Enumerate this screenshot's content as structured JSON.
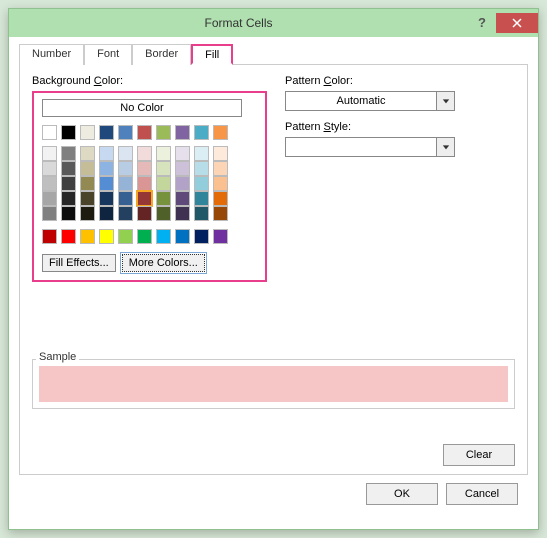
{
  "title": "Format Cells",
  "tabs": {
    "number": "Number",
    "font": "Font",
    "border": "Border",
    "fill": "Fill"
  },
  "labels": {
    "bgcolor_pre": "Background ",
    "bgcolor_u": "C",
    "bgcolor_post": "olor:",
    "nocolor_pre": "",
    "nocolor_u": "N",
    "nocolor_post": "o Color",
    "fe_pre": "Fill ",
    "fe_u": "E",
    "fe_post": "ffects...",
    "mc_u": "M",
    "mc_post": "ore Colors...",
    "pc_pre": "Pattern ",
    "pc_u": "C",
    "pc_post": "olor:",
    "ps_pre": "Pattern ",
    "ps_u": "S",
    "ps_post": "tyle:",
    "sample": "Sample",
    "clear": "Clea",
    "clear_u": "r",
    "ok": "OK",
    "cancel": "Cancel"
  },
  "pattern_color_value": "Automatic",
  "pattern_style_value": "",
  "sample_color": "#f6c6c6",
  "theme_colors_row1": [
    "#ffffff",
    "#000000",
    "#eeece1",
    "#1f497d",
    "#4f81bd",
    "#c0504d",
    "#9bbb59",
    "#8064a2",
    "#4bacc6",
    "#f79646"
  ],
  "theme_shades": [
    [
      "#f2f2f2",
      "#7f7f7f",
      "#ddd9c3",
      "#c6d9f0",
      "#dbe5f1",
      "#f2dcdb",
      "#ebf1dd",
      "#e5e0ec",
      "#dbeef3",
      "#fdeada"
    ],
    [
      "#d9d9d9",
      "#595959",
      "#c4bd97",
      "#8db3e2",
      "#b8cce4",
      "#e5b9b7",
      "#d7e3bc",
      "#ccc1d9",
      "#b7dde8",
      "#fbd5b5"
    ],
    [
      "#bfbfbf",
      "#404040",
      "#938953",
      "#548dd4",
      "#95b3d7",
      "#d99694",
      "#c3d69b",
      "#b2a2c7",
      "#92cddc",
      "#fac08f"
    ],
    [
      "#a6a6a6",
      "#262626",
      "#494429",
      "#17365d",
      "#366092",
      "#953734",
      "#76923c",
      "#5f497a",
      "#31859b",
      "#e36c09"
    ],
    [
      "#808080",
      "#0d0d0d",
      "#1d1b10",
      "#0f243e",
      "#244061",
      "#632423",
      "#4f6128",
      "#3f3151",
      "#205867",
      "#974806"
    ]
  ],
  "standard_colors": [
    "#c00000",
    "#ff0000",
    "#ffc000",
    "#ffff00",
    "#92d050",
    "#00b050",
    "#00b0f0",
    "#0070c0",
    "#002060",
    "#7030a0"
  ],
  "selected_theme": "3-5"
}
